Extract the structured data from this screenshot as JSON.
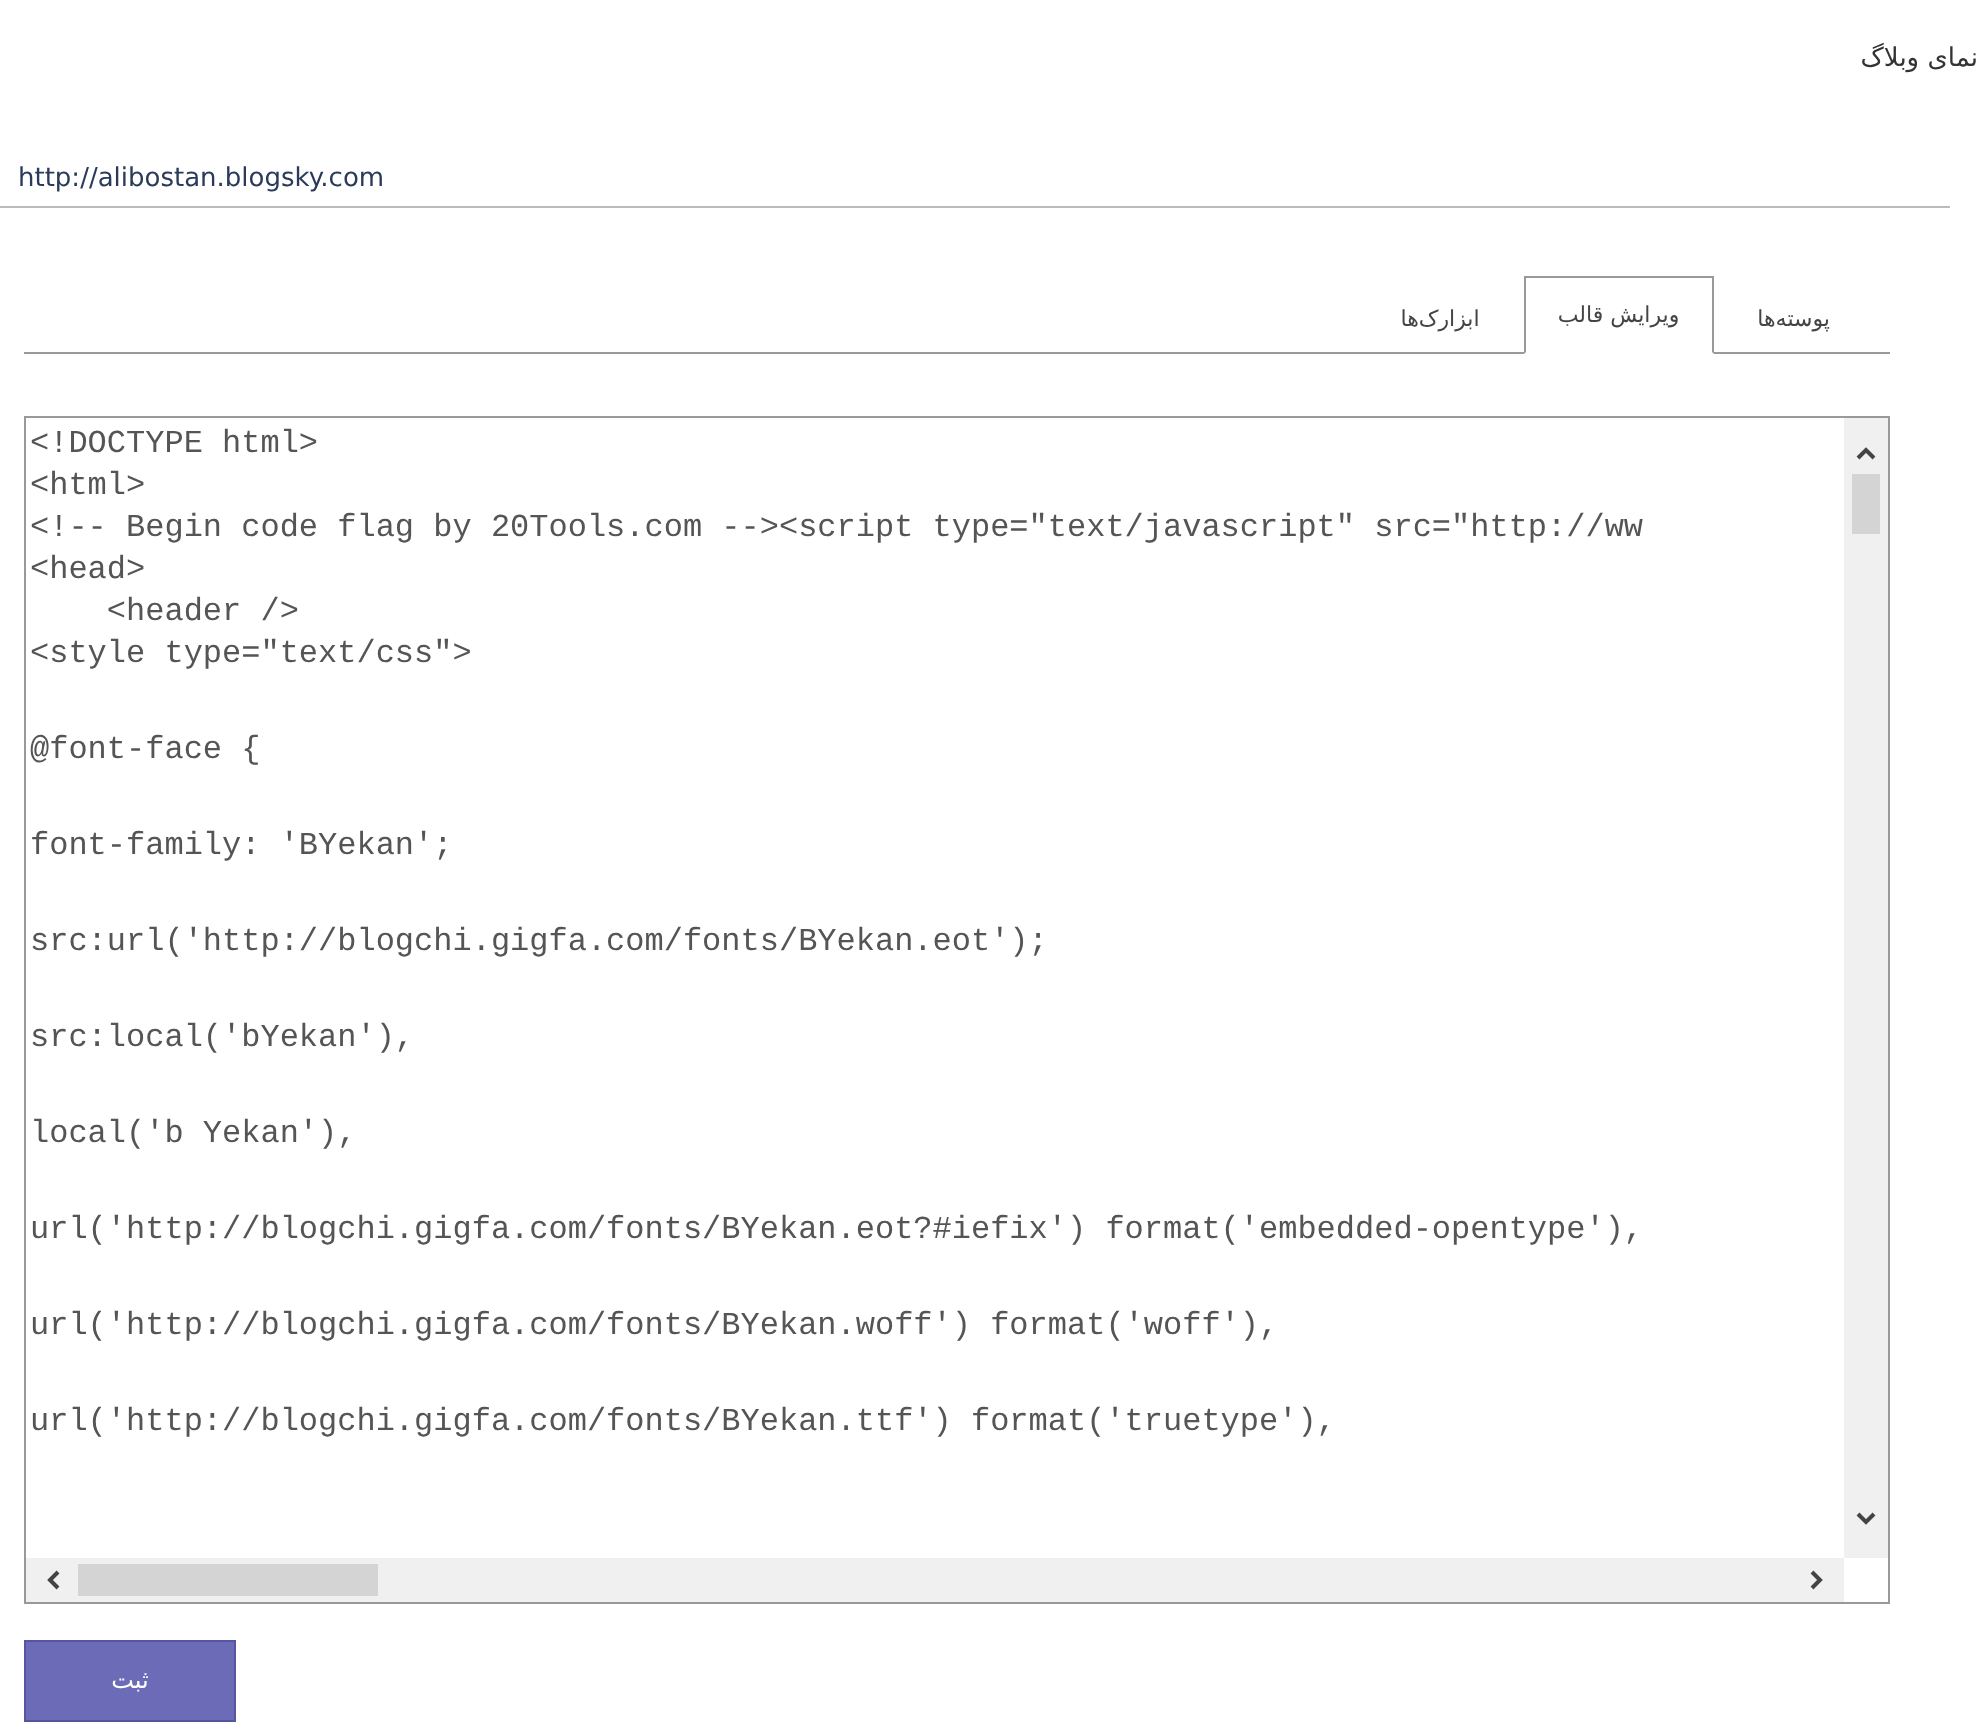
{
  "page_title": "نمای وبلاگ",
  "blog_url": "http://alibostan.blogsky.com",
  "tabs": [
    {
      "label": "پوسته‌ها",
      "selected": false
    },
    {
      "label": "ویرایش قالب",
      "selected": true
    },
    {
      "label": "ابزارک‌ها",
      "selected": false
    }
  ],
  "editor": {
    "lines": [
      {
        "text": "<!DOCTYPE html>",
        "kind": "tight"
      },
      {
        "text": "<html>",
        "kind": "tight"
      },
      {
        "text": "<!-- Begin code flag by 20Tools.com --><script type=\"text/javascript\" src=\"http://ww",
        "kind": "tight"
      },
      {
        "text": "<head>",
        "kind": "tight"
      },
      {
        "text": "    <header />",
        "kind": "tight"
      },
      {
        "text": "<style type=\"text/css\">",
        "kind": "tight"
      },
      {
        "text": "@font-face {",
        "kind": "spaced"
      },
      {
        "text": "font-family: 'BYekan';",
        "kind": "spaced"
      },
      {
        "text": "src:url('http://blogchi.gigfa.com/fonts/BYekan.eot');",
        "kind": "spaced"
      },
      {
        "text": "src:local('bYekan'),",
        "kind": "spaced"
      },
      {
        "text": "local('b Yekan'),",
        "kind": "spaced"
      },
      {
        "text": "url('http://blogchi.gigfa.com/fonts/BYekan.eot?#iefix') format('embedded-opentype'),",
        "kind": "spaced"
      },
      {
        "text": "url('http://blogchi.gigfa.com/fonts/BYekan.woff') format('woff'),",
        "kind": "spaced"
      },
      {
        "text": "url('http://blogchi.gigfa.com/fonts/BYekan.ttf') format('truetype'),",
        "kind": "spaced"
      }
    ]
  },
  "submit_button": "ثبت"
}
